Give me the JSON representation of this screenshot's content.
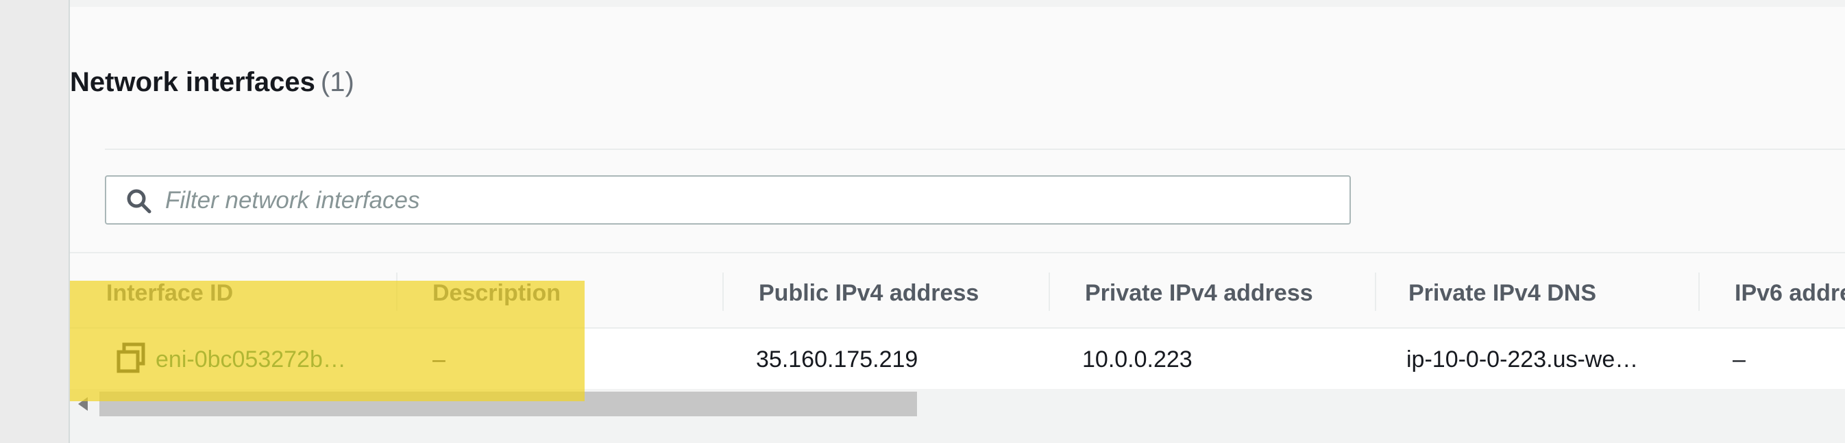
{
  "section": {
    "title": "Network interfaces",
    "count": "(1)"
  },
  "filter": {
    "placeholder": "Filter network interfaces",
    "value": ""
  },
  "table": {
    "columns": [
      "Interface ID",
      "Description",
      "Public IPv4 address",
      "Private IPv4 address",
      "Private IPv4 DNS",
      "IPv6 addre"
    ],
    "rows": [
      {
        "interface_id": "eni-0bc053272b…",
        "description": "–",
        "public_ipv4": "35.160.175.219",
        "private_ipv4": "10.0.0.223",
        "private_ipv4_dns": "ip-10-0-0-223.us-we…",
        "ipv6": "–"
      }
    ]
  },
  "icons": {
    "filter": "search-icon",
    "row_copy": "copy-icon"
  },
  "colors": {
    "link": "#0b6a4f",
    "highlight": "#f0d428",
    "header_text": "#545b64"
  }
}
